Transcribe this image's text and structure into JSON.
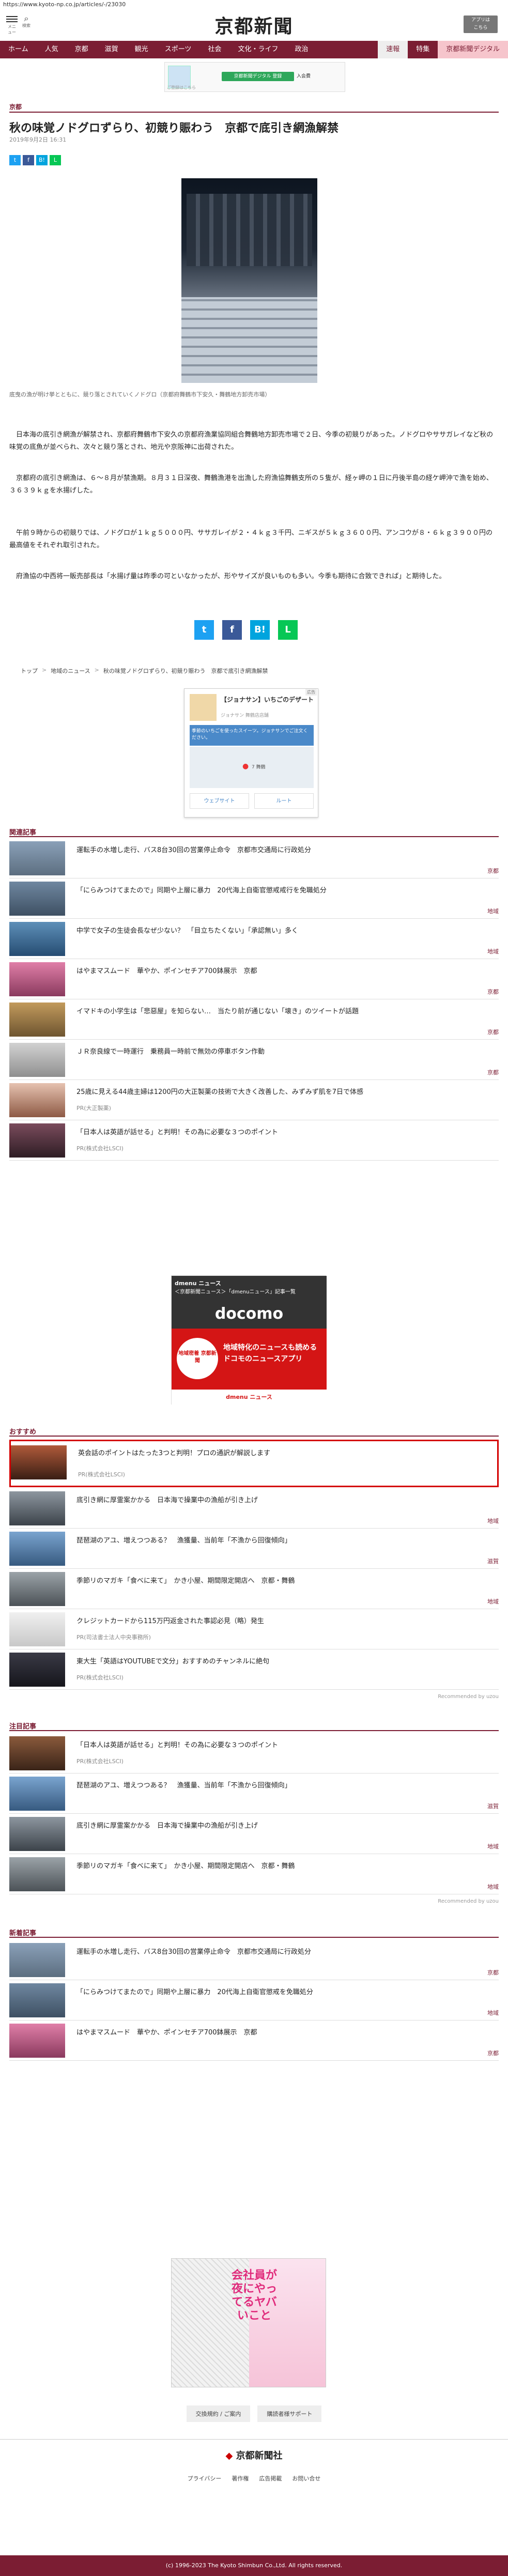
{
  "url": "https://www.kyoto-np.co.jp/articles/-/23030",
  "header": {
    "menu_label": "メニュー",
    "search_label": "検索",
    "logo": "京都新聞",
    "app_label_1": "アプリは",
    "app_label_2": "こちら"
  },
  "nav": {
    "items": [
      "ホーム",
      "人気",
      "京都",
      "滋賀",
      "観光",
      "スポーツ",
      "社会",
      "文化・ライフ",
      "政治"
    ],
    "right_items": [
      "速報",
      "特集",
      "京都新聞デジタル"
    ]
  },
  "ad_top": {
    "button": "京都新聞デジタル 登録",
    "tail": "入会費",
    "caption": "ご登録はこちら"
  },
  "article": {
    "section": "京都",
    "title": "秋の味覚ノドグロずらり、初競り賑わう　京都で底引き網漁解禁",
    "date": "2019年9月2日 16:31",
    "caption": "底曳の漁が明け挙とともに、競り落とされていくノドグロ（京都府舞鶴市下安久・舞鶴地方卸売市場）",
    "paragraphs": [
      "　日本海の底引き網漁が解禁され、京都府舞鶴市下安久の京都府漁業協同組合舞鶴地方卸売市場で２日、今季の初競りがあった。ノドグロやササガレイなど秋の味覚の底魚が並べられ、次々と競り落とされ、地元や京阪神に出荷された。",
      "　京都府の底引き網漁は、６～８月が禁漁期。８月３１日深夜、舞鶴漁港を出漁した府漁協舞鶴支所の５隻が、経ヶ岬の１日に丹後半島の経ケ岬沖で漁を始め、３６３９ｋｇを水揚げした。",
      "　午前９時からの初競りでは、ノドグロが１ｋｇ５０００円、ササガレイが２・４ｋｇ３千円、ニギスが５ｋｇ３６００円、アンコウが８・６ｋｇ３９００円の最高値をそれぞれ取引された。",
      "　府漁協の中西将一販売部長は「水揚げ量は昨季の可といなかったが、形やサイズが良いものも多い。今季も期待に合致できれば」と期待した。"
    ]
  },
  "share": {
    "small": [
      "t",
      "f",
      "B!",
      "L"
    ],
    "large": [
      "t",
      "f",
      "B!",
      "L"
    ]
  },
  "breadcrumb": [
    "トップ",
    "地域のニュース",
    "秋の味覚ノドグロずらり、初競り賑わう　京都で底引き網漁解禁"
  ],
  "ad_box": {
    "mark": "広告",
    "title": "【ジョナサン】いちごのデザート",
    "sub": "ジョナサン 舞鶴店店舗",
    "banner": "季節のいちごを使ったスイーツ。ジョナサンでご注文ください。",
    "map_label": "7 舞鶴",
    "btn1": "ウェブサイト",
    "btn2": "ルート"
  },
  "related": {
    "title": "関連記事",
    "items": [
      {
        "title": "運転手の水増し走行、バス8台30回の営業停止命令　京都市交通局に行政処分",
        "tag": "京都"
      },
      {
        "title": "「にらみつけてまたので」同期や上層に暴力　20代海上自衛官懲戒戒行を免職処分",
        "tag": "地域"
      },
      {
        "title": "中学で女子の生徒会長なぜ少ない？　「目立ちたくない」「承認無い」多く",
        "tag": "地域"
      },
      {
        "title": "はやまマスムード　華やか、ポインセチア700鉢展示　京都",
        "tag": "京都"
      },
      {
        "title": "イマドキの小学生は「悲惡屋」を知らない…　当たり前が通じない「壊き」のツイートが話題",
        "tag": "京都"
      },
      {
        "title": "ＪＲ奈良線で一時運行　乗務員一時前で無効の停車ボタン作動",
        "tag": "京都"
      },
      {
        "title": "25歳に見える44歳主婦は1200円の大正製薬の技術で大きく改善した、みずみず肌を7日で体感",
        "pr": "PR(大正製薬)"
      },
      {
        "title": "「日本人は英語が話せる」と判明！その為に必要な３つのポイント",
        "pr": "PR(株式会社LSCI)"
      }
    ]
  },
  "dmenu": {
    "top": "＜京都新聞ニュース＞「dmenuニュース」記事一覧",
    "sub": "dmenu ニュース",
    "brand": "docomo",
    "circle": "地域密着 京都新聞",
    "message": "地域特化のニュースも読める ドコモのニュースアプリ",
    "foot": "dmenu ニュース"
  },
  "recommend": {
    "title": "おすすめ",
    "items": [
      {
        "title": "英会話のポイントはたった3つと判明！プロの通訳が解説します",
        "pr": "PR(株式会社LSCI)",
        "highlight": true
      },
      {
        "title": "底引き網に厚霊案かかる　日本海で操業中の漁船が引き上げ",
        "tag": "地域"
      },
      {
        "title": "琵琶湖のアユ、増えつつある？　漁獲量、当前年「不漁から回復傾向」",
        "tag": "滋賀"
      },
      {
        "title": "季節リのマガキ「食べに来て」　かき小屋、期間限定開店へ　京都・舞鶴",
        "tag": "地域"
      },
      {
        "title": "クレジットカードから115万円返金された事認必見（略）発生",
        "pr": "PR(司法書士法人中央事務所)"
      },
      {
        "title": "東大生「英語はYOUTUBEで文分」おすすめのチャンネルに絶句",
        "pr": "PR(株式会社LSCI)"
      }
    ],
    "by": "Recommended by uzou"
  },
  "attention": {
    "title": "注目記事",
    "items": [
      {
        "title": "「日本人は英語が話せる」と判明！その為に必要な３つのポイント",
        "pr": "PR(株式会社LSCI)"
      },
      {
        "title": "琵琶湖のアユ、増えつつある？　漁獲量、当前年「不漁から回復傾向」",
        "tag": "滋賀"
      },
      {
        "title": "底引き網に厚霊案かかる　日本海で操業中の漁船が引き上げ",
        "tag": "地域"
      },
      {
        "title": "季節リのマガキ「食べに来て」　かき小屋、期間限定開店へ　京都・舞鶴",
        "tag": "地域"
      }
    ],
    "by": "Recommended by uzou"
  },
  "latest": {
    "title": "新着記事",
    "items": [
      {
        "title": "運転手の水増し走行、バス8台30回の営業停止命令　京都市交通局に行政処分",
        "tag": "京都"
      },
      {
        "title": "「にらみつけてまたので」同期や上層に暴力　20代海上自衛官懲戒を免職処分",
        "tag": "地域"
      },
      {
        "title": "はやまマスムード　華やか、ポインセチア700鉢展示　京都",
        "tag": "京都"
      }
    ]
  },
  "manga_ad": {
    "text": "会社員が夜にやってるヤバいこと"
  },
  "footer_links": [
    "交換規約 / ご案内",
    "購読者様サポート"
  ],
  "footer": {
    "logo": "京都新聞社",
    "links": [
      "プライバシー",
      "著作権",
      "広告掲載",
      "お問い合せ"
    ],
    "copyright": "(c) 1996-2023 The Kyoto Shimbun Co.,Ltd. All rights reserved."
  }
}
